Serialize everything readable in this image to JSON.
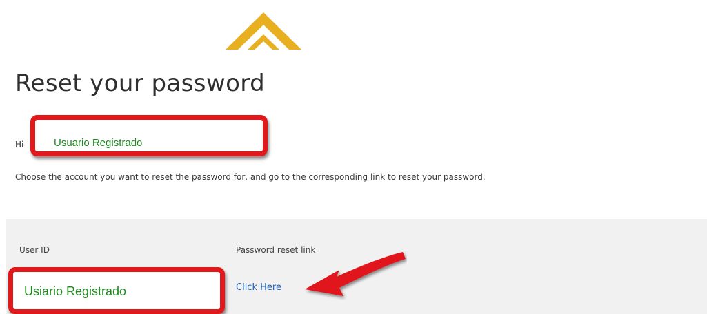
{
  "logo": {
    "icon": "double-chevron-up-logo",
    "color": "#e8b020"
  },
  "page": {
    "title": "Reset your password",
    "greeting_label": "Hi",
    "greeting_name": "Usuario Registrado",
    "instructions": "Choose the account you want to reset the password for, and go to the corresponding link to reset your password."
  },
  "table": {
    "columns": [
      "User ID",
      "Password reset link"
    ],
    "rows": [
      {
        "user_id": "Usiario Registrado",
        "link_label": "Click Here"
      }
    ]
  },
  "annotations": {
    "highlight_color": "#e0191c",
    "arrow_icon": "red-arrow-icon"
  }
}
